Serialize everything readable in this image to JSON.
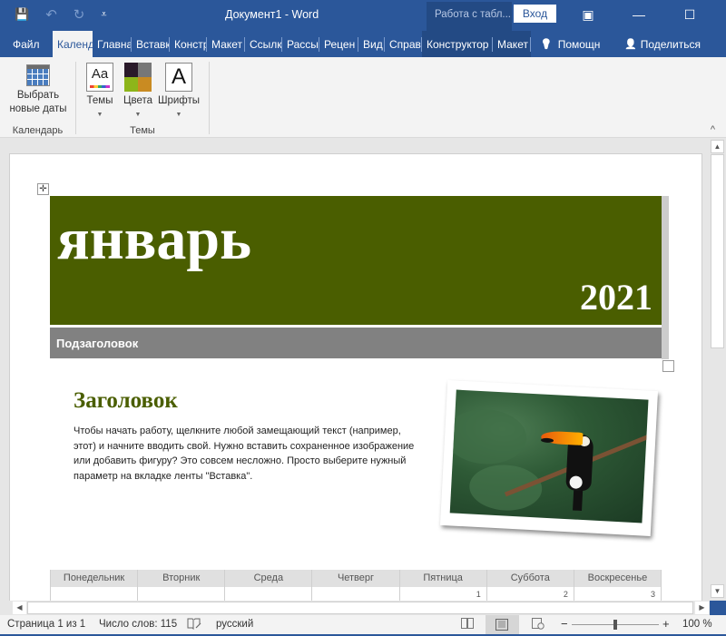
{
  "window": {
    "title": "Документ1  -  Word",
    "context_title": "Работа с табл...",
    "signin_label": "Вход",
    "icons": {
      "save": "💾",
      "undo": "↶",
      "redo": "↻",
      "customize": "⩡",
      "ribbon_display": "▣",
      "minimize": "—",
      "maximize": "☐",
      "close": "✕"
    }
  },
  "tabs": [
    {
      "label": "Файл"
    },
    {
      "label": "Календ"
    },
    {
      "label": "Главна"
    },
    {
      "label": "Вставк"
    },
    {
      "label": "Констр"
    },
    {
      "label": "Макет"
    },
    {
      "label": "Ссылк"
    },
    {
      "label": "Рассы"
    },
    {
      "label": "Рецен"
    },
    {
      "label": "Вид"
    },
    {
      "label": "Справ"
    },
    {
      "label": "Конструктор"
    },
    {
      "label": "Макет"
    },
    {
      "label": "Помощн",
      "icon": "💡"
    },
    {
      "label": "Поделиться",
      "icon": "👤"
    }
  ],
  "ribbon": {
    "groups": [
      {
        "label": "Календарь",
        "buttons": [
          {
            "label_line1": "Выбрать",
            "label_line2": "новые даты"
          }
        ]
      },
      {
        "label": "Темы",
        "buttons": [
          {
            "label": "Темы",
            "glyph": "Aa"
          },
          {
            "label": "Цвета"
          },
          {
            "label": "Шрифты",
            "glyph": "A"
          }
        ]
      }
    ],
    "collapse_icon": "^"
  },
  "document": {
    "month": "январь",
    "year": "2021",
    "subtitle": "Подзаголовок",
    "heading": "Заголовок",
    "body": "Чтобы начать работу, щелкните любой замещающий текст (например, этот) и начните вводить свой. Нужно вставить сохраненное изображение или добавить фигуру? Это совсем несложно. Просто выберите нужный параметр на вкладке ленты \"Вставка\".",
    "move_handle": "✛",
    "accent_color": "#4a5e00",
    "calendar": {
      "days": [
        "Понедельник",
        "Вторник",
        "Среда",
        "Четверг",
        "Пятница",
        "Суббота",
        "Воскресенье"
      ],
      "week1": [
        "",
        "",
        "",
        "",
        "1",
        "2",
        "3"
      ]
    }
  },
  "scroll": {
    "up": "▲",
    "down": "▼",
    "left": "◀",
    "right": "▶"
  },
  "status": {
    "page": "Страница 1 из 1",
    "words": "Число слов: 115",
    "language": "русский",
    "zoom": "100 %",
    "zoom_minus": "−",
    "zoom_plus": "+"
  }
}
